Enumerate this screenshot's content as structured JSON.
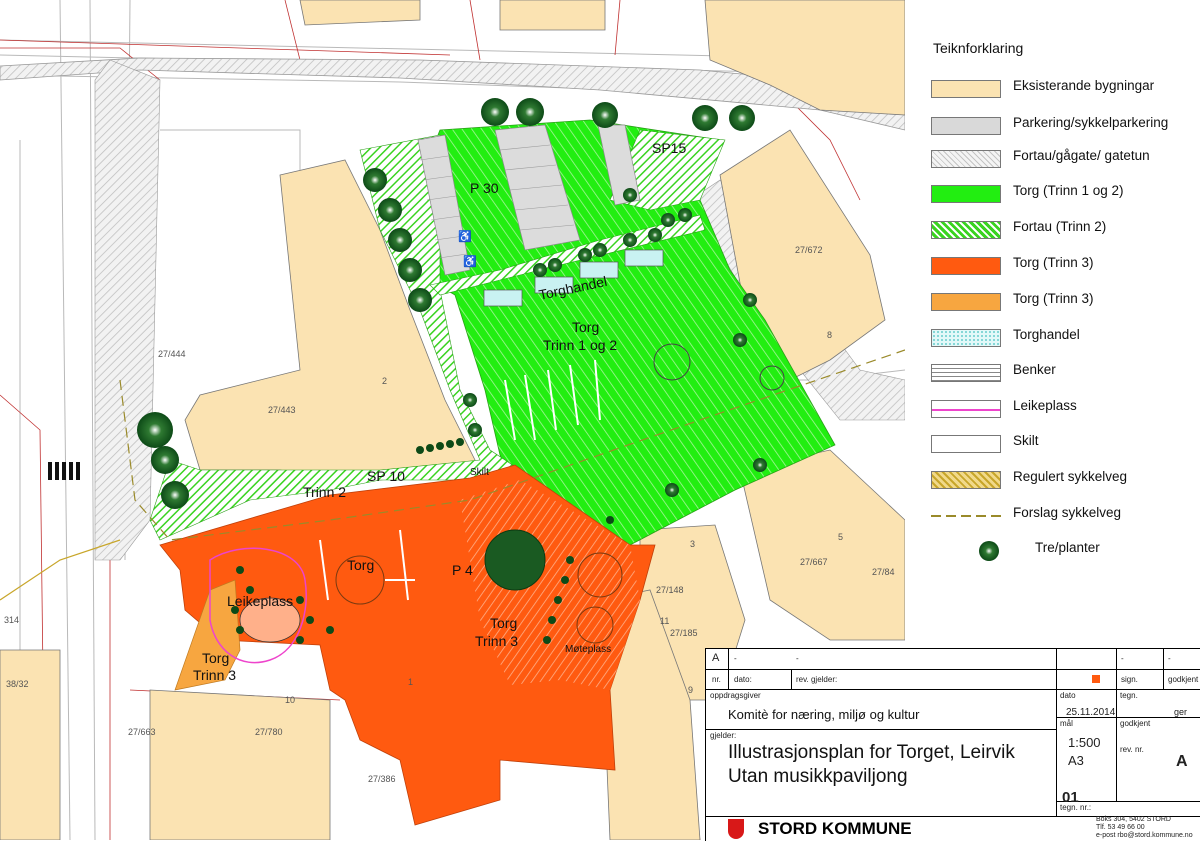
{
  "map": {
    "labels": {
      "p30": "P 30",
      "sp15": "SP15",
      "torghandel": "Torghandel",
      "torg_trinn12_a": "Torg",
      "torg_trinn12_b": "Trinn 1 og 2",
      "sp10": "SP 10",
      "trinn2": "Trinn 2",
      "skilt": "Skilt",
      "torg_small": "Torg",
      "p4": "P 4",
      "leikeplass": "Leikeplass",
      "torg_trinn3_a": "Torg",
      "torg_trinn3_b": "Trinn 3",
      "torg_trinn3_left_a": "Torg",
      "torg_trinn3_left_b": "Trinn 3",
      "moteplass": "Møteplass"
    },
    "parcels": {
      "p27_672": "27/672",
      "p8": "8",
      "p27_444": "27/444",
      "p27_443": "27/443",
      "p2": "2",
      "p5": "5",
      "p27_667": "27/667",
      "p27_84": "27/84",
      "p3": "3",
      "p27_148": "27/148",
      "p11": "11",
      "p27_185": "27/185",
      "p9": "9",
      "p1": "1",
      "p10": "10",
      "p27_663": "27/663",
      "p27_780": "27/780",
      "p27_386": "27/386",
      "p314": "314",
      "p38_32": "38/32"
    }
  },
  "legend": {
    "title": "Teiknforklaring",
    "items": [
      {
        "label": "Eksisterande bygningar",
        "color": "#fbe3b2"
      },
      {
        "label": "Parkering/sykkelparkering",
        "color": "#d9d9d9"
      },
      {
        "label": "Fortau/gågate/ gatetun",
        "color": "#eeeeee"
      },
      {
        "label": "Torg (Trinn 1 og 2)",
        "color": "#22ee11"
      },
      {
        "label": "Fortau (Trinn 2)",
        "color": "#55dd33"
      },
      {
        "label": "Torg (Trinn 3)",
        "color": "#ff5a10"
      },
      {
        "label": "Torg (Trinn 3)",
        "color": "#f7a640"
      },
      {
        "label": "Torghandel",
        "color": "#c9f2f2"
      },
      {
        "label": "Benker",
        "color": "#ffffff"
      },
      {
        "label": "Leikeplass",
        "color": "#ee44cc"
      },
      {
        "label": "Skilt",
        "color": "#ffffff"
      },
      {
        "label": "Regulert sykkelveg",
        "color": "#c8a62a"
      },
      {
        "label": "Forslag sykkelveg",
        "color": "#9a8a2a"
      },
      {
        "label": "Tre/planter",
        "color": "#1a5a22"
      }
    ]
  },
  "title_block": {
    "rev_a": "A",
    "dash1": "-",
    "dash2": "-",
    "dash3": "-",
    "dash4": "-",
    "nr": "nr.",
    "dato": "dato:",
    "rev_gjelder": "rev. gjelder:",
    "sign": "sign.",
    "godkjent": "godkjent",
    "oppdragsgiver_label": "oppdragsgiver",
    "oppdragsgiver": "Komitè for næring, miljø og kultur",
    "dato_label": "dato",
    "dato_value": "25.11.2014",
    "tegn_label": "tegn.",
    "tegn_value": "ger",
    "gjelder_label": "gjelder:",
    "title1": "Illustrasjonsplan for Torget, Leirvik",
    "title2": "Utan musikkpaviljong",
    "maal_label": "mål",
    "godkjent_label": "godkjent",
    "scale": "1:500",
    "paper": "A3",
    "rev_nr_label": "rev. nr.",
    "rev_nr": "A",
    "tegn_nr_label": "tegn. nr.:",
    "tegn_nr": "01",
    "org": "STORD KOMMUNE",
    "addr1": "Boks 304, 5402 STORD",
    "tlf": "Tlf.       53 49 66 00",
    "epost": "e-post   rbo@stord.kommune.no"
  }
}
